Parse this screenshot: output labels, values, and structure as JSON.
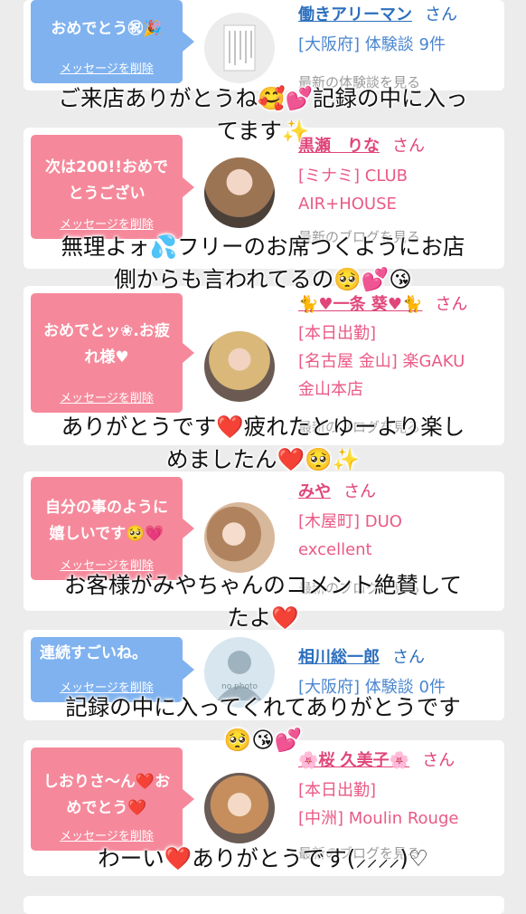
{
  "cards": [
    {
      "message": "おめでとう㊗🎉",
      "delete_label": "メッセージを削除",
      "name": "働きアリーマン",
      "san": "さん",
      "info": [
        "[大阪府] 体験談 9件"
      ],
      "link": "最新の体験談を見る"
    },
    {
      "message": "次は200!!おめでとうござい",
      "delete_label": "メッセージを削除",
      "name": "黒瀬　りな",
      "san": "さん",
      "info": [
        "[ミナミ] CLUB",
        "AIR+HOUSE"
      ],
      "link": "最新のブログを見る"
    },
    {
      "message": "おめでとッ❀.お疲れ様♥",
      "delete_label": "メッセージを削除",
      "name": "🐈♥一条 葵♥🐈",
      "san": "さん",
      "info": [
        "[本日出勤]",
        "[名古屋 金山] 楽GAKU",
        "金山本店"
      ],
      "link": "最新のブログを見る"
    },
    {
      "message": "自分の事のように嬉しいです🥺💗",
      "delete_label": "メッセージを削除",
      "name": "みや",
      "san": "さん",
      "info": [
        "[木屋町] DUO",
        "excellent"
      ],
      "link": "最新のブログを見る"
    },
    {
      "message": "連続すごいね。",
      "delete_label": "メッセージを削除",
      "name": "相川総一郎",
      "san": "さん",
      "info": [
        "[大阪府] 体験談 0件"
      ],
      "link": "",
      "avatar_text": "no photo"
    },
    {
      "message": "しおりさ〜ん❤️おめでとう❤️",
      "delete_label": "メッセージを削除",
      "name": "🌸桜 久美子🌸",
      "san": "さん",
      "info": [
        "[本日出勤]",
        "[中洲] Moulin Rouge"
      ],
      "link": "最新のブログを見る"
    }
  ],
  "overlays": [
    "ご来店ありがとうね🥰💕記録の中に入っ",
    "てます✨",
    "無理よォ💦フリーのお席つくようにお店",
    "側からも言われてるの🥺💕😘",
    "ありがとうです❤️疲れたとゆーより楽し",
    "めましたん❤️🥺✨",
    "お客様がみやちゃんのコメント絶賛して",
    "たよ❤️",
    "記録の中に入ってくれてありがとうです",
    "🥺😘💕",
    "わーい❤️ありがとうです(⸝⸝⸝⸝)♡"
  ],
  "colors": {
    "blue_bubble": "#7fb2ef",
    "pink_bubble": "#f5899b",
    "blue_text": "#2c6fbd",
    "pink_text": "#e0467a",
    "background": "#ececec"
  }
}
